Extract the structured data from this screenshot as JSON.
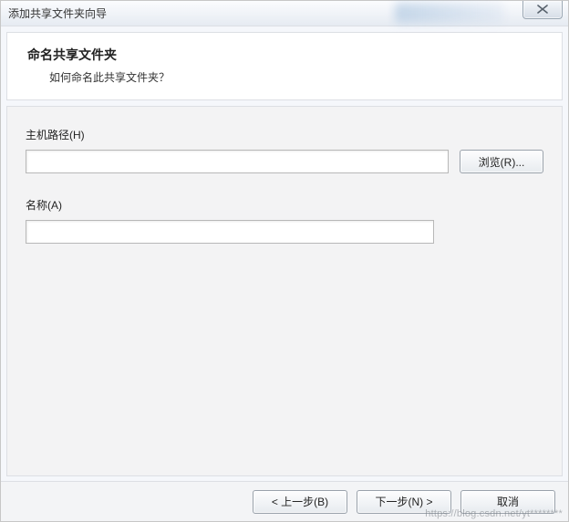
{
  "window": {
    "title": "添加共享文件夹向导"
  },
  "header": {
    "title": "命名共享文件夹",
    "subtitle": "如何命名此共享文件夹？"
  },
  "form": {
    "host_path": {
      "label": "主机路径(H)",
      "value": "",
      "browse_button": "浏览(R)..."
    },
    "name": {
      "label": "名称(A)",
      "value": ""
    }
  },
  "footer": {
    "back": "< 上一步(B)",
    "next": "下一步(N) >",
    "cancel": "取消"
  },
  "watermark": "https://blog.csdn.net/yt********"
}
